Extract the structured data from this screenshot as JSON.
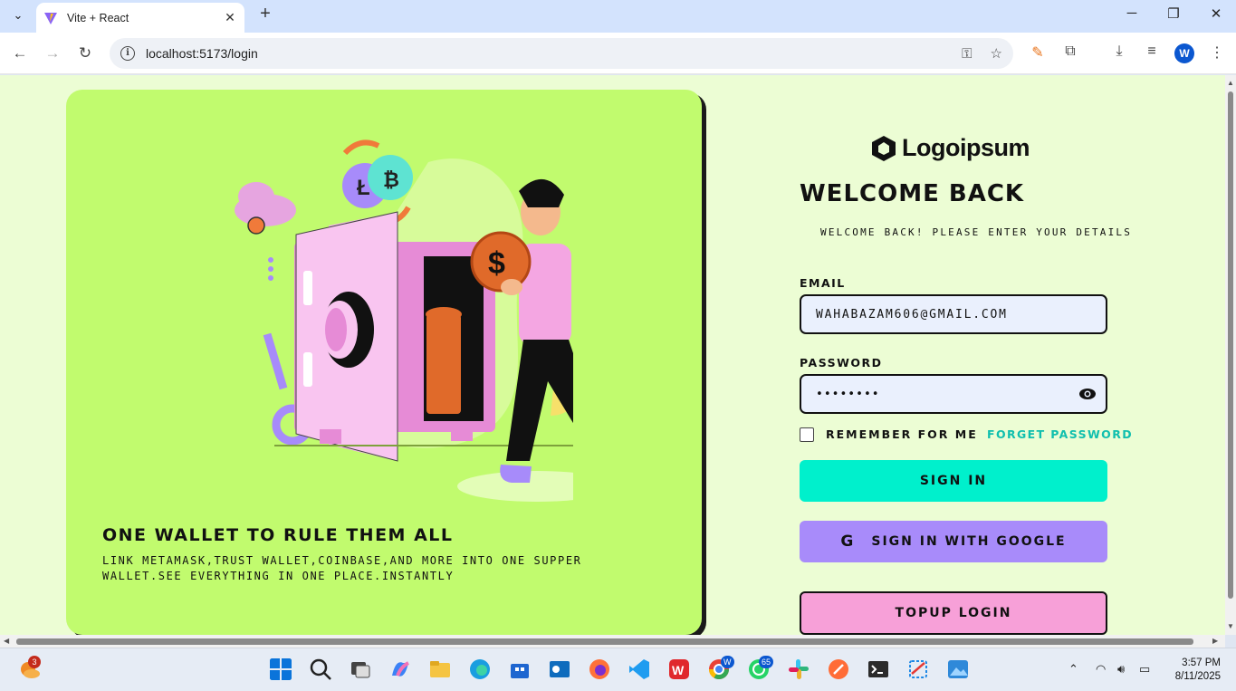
{
  "browser": {
    "tab_title": "Vite + React",
    "url": "localhost:5173/login",
    "profile_initial": "W"
  },
  "hero": {
    "title": "ONE WALLET TO RULE THEM ALL",
    "subtitle": "LINK METAMASK,TRUST WALLET,COINBASE,AND MORE INTO ONE SUPPER WALLET.SEE EVERYTHING IN ONE PLACE.INSTANTLY"
  },
  "form": {
    "logo_text": "Logoipsum",
    "heading": "WELCOME BACK",
    "subheading": "WELCOME BACK! PLEASE ENTER YOUR DETAILS",
    "email_label": "EMAIL",
    "email_value": "WAHABAZAM606@GMAIL.COM",
    "password_label": "PASSWORD",
    "password_value": "••••••••",
    "remember_label": "REMEMBER FOR ME",
    "forgot_label": "FORGET PASSWORD",
    "signin_label": "SIGN IN",
    "google_icon": "G",
    "google_label": "SIGN IN WITH GOOGLE",
    "topup_label": "TOPUP LOGIN"
  },
  "taskbar": {
    "weather_badge": "3",
    "chrome_badge": "W",
    "whatsapp_badge": "65",
    "time": "3:57 PM",
    "date": "8/11/2025"
  },
  "colors": {
    "page_bg": "#ecfdd4",
    "hero_bg": "#c1fb6e",
    "signin": "#00f0cc",
    "google": "#a88bfa",
    "topup": "#f7a0d8",
    "forgot": "#0fbfae"
  }
}
